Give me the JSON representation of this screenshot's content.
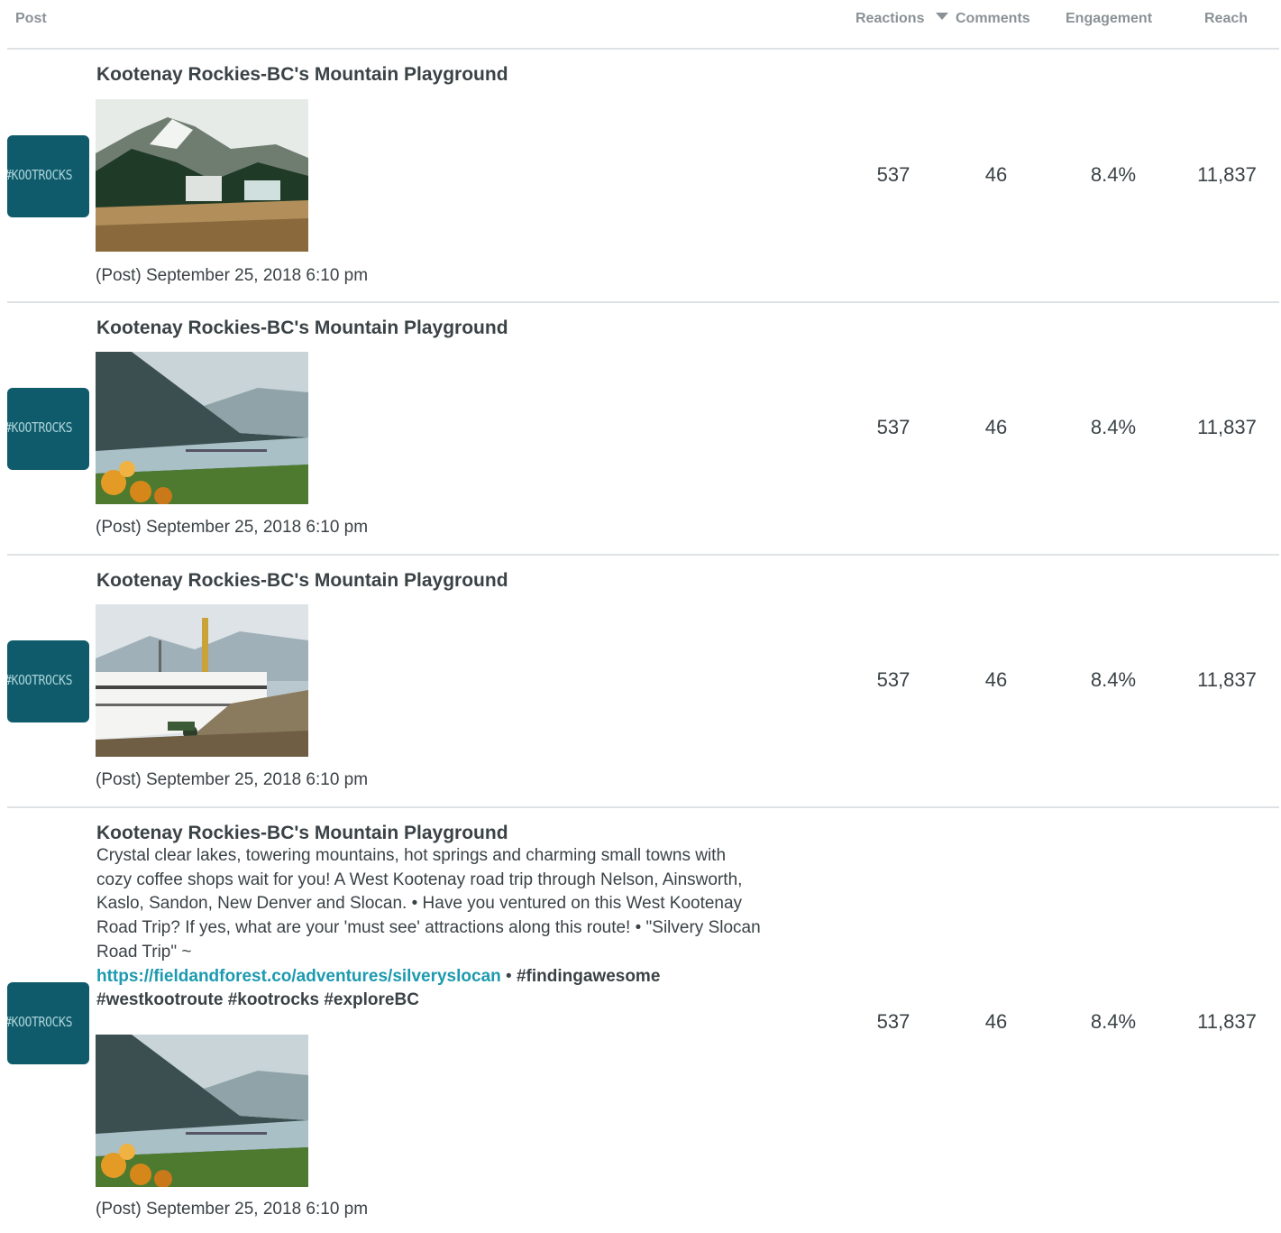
{
  "header": {
    "post": "Post",
    "reactions": "Reactions",
    "comments": "Comments",
    "engagement": "Engagement",
    "reach": "Reach"
  },
  "avatar_text": "#KOOTROCKS",
  "posts": [
    {
      "title": "Kootenay Rockies-BC's Mountain Playground",
      "date": "(Post) September 25, 2018 6:10 pm",
      "reactions": "537",
      "comments": "46",
      "engagement": "8.4%",
      "reach": "11,837"
    },
    {
      "title": "Kootenay Rockies-BC's Mountain Playground",
      "date": "(Post) September 25, 2018 6:10 pm",
      "reactions": "537",
      "comments": "46",
      "engagement": "8.4%",
      "reach": "11,837"
    },
    {
      "title": "Kootenay Rockies-BC's Mountain Playground",
      "date": "(Post) September 25, 2018 6:10 pm",
      "reactions": "537",
      "comments": "46",
      "engagement": "8.4%",
      "reach": "11,837"
    },
    {
      "title": "Kootenay Rockies-BC's Mountain Playground",
      "body_text": "Crystal clear lakes, towering mountains, hot springs and charming small towns with cozy coffee shops wait for you! A West Kootenay road trip through Nelson, Ainsworth, Kaslo, Sandon, New Denver and Slocan. • Have you ventured on this West Kootenay Road Trip? If yes, what are your 'must see' attractions along this route! • \"Silvery Slocan Road Trip\" ~",
      "link": "https://fieldandforest.co/adventures/silveryslocan",
      "separator": " • ",
      "hashtags_line1": "#findingawesome",
      "hashtags_line2": "#westkootroute #kootrocks #exploreBC",
      "date": "(Post) September 25, 2018 6:10 pm",
      "reactions": "537",
      "comments": "46",
      "engagement": "8.4%",
      "reach": "11,837"
    }
  ]
}
